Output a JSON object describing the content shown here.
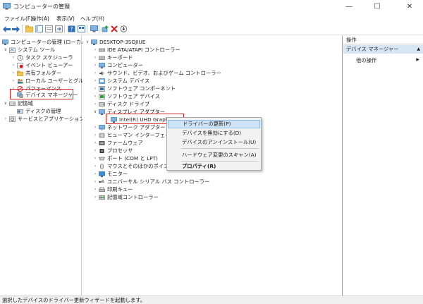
{
  "window": {
    "title": "コンピューターの管理",
    "controls": {
      "minimize": "—",
      "maximize": "☐",
      "close": "✕"
    }
  },
  "menu": [
    "ファイル(F)",
    "操作(A)",
    "表示(V)",
    "ヘルプ(H)"
  ],
  "toolbar_icons": [
    "back-arrow-icon",
    "forward-arrow-icon",
    "up-folder-icon",
    "console-tree-icon",
    "properties-icon",
    "export-list-icon",
    "help-icon",
    "view-icon",
    "monitor-icon",
    "update-driver-icon",
    "uninstall-icon",
    "scan-icon"
  ],
  "left_tree": [
    {
      "label": "コンピューターの管理 (ローカル)",
      "expander": "",
      "icon": "computer-management-icon",
      "level": 0
    },
    {
      "label": "システム ツール",
      "expander": "∨",
      "icon": "system-tools-icon",
      "level": 1
    },
    {
      "label": "タスク スケジューラ",
      "expander": "›",
      "icon": "task-scheduler-icon",
      "level": 2
    },
    {
      "label": "イベント ビューアー",
      "expander": "›",
      "icon": "event-viewer-icon",
      "level": 2
    },
    {
      "label": "共有フォルダー",
      "expander": "›",
      "icon": "shared-folder-icon",
      "level": 2
    },
    {
      "label": "ローカル ユーザーとグループ",
      "expander": "›",
      "icon": "users-icon",
      "level": 2
    },
    {
      "label": "パフォーマンス",
      "expander": "›",
      "icon": "performance-icon",
      "level": 2
    },
    {
      "label": "デバイス マネージャー",
      "expander": "",
      "icon": "device-manager-icon",
      "level": 2
    },
    {
      "label": "記憶域",
      "expander": "∨",
      "icon": "storage-icon",
      "level": 1
    },
    {
      "label": "ディスクの管理",
      "expander": "",
      "icon": "disk-management-icon",
      "level": 2
    },
    {
      "label": "サービスとアプリケーション",
      "expander": "›",
      "icon": "services-icon",
      "level": 1
    }
  ],
  "device_tree": [
    {
      "label": "DESKTOP-3SOJIUE",
      "expander": "∨",
      "icon": "computer-icon",
      "level": 0
    },
    {
      "label": "IDE ATA/ATAPI コントローラー",
      "expander": "›",
      "icon": "ide-controller-icon",
      "level": 1
    },
    {
      "label": "キーボード",
      "expander": "›",
      "icon": "keyboard-icon",
      "level": 1
    },
    {
      "label": "コンピューター",
      "expander": "›",
      "icon": "computer-icon",
      "level": 1
    },
    {
      "label": "サウンド、ビデオ、およびゲーム コントローラー",
      "expander": "›",
      "icon": "sound-icon",
      "level": 1
    },
    {
      "label": "システム デバイス",
      "expander": "›",
      "icon": "system-device-icon",
      "level": 1
    },
    {
      "label": "ソフトウェア コンポーネント",
      "expander": "›",
      "icon": "software-component-icon",
      "level": 1
    },
    {
      "label": "ソフトウェア デバイス",
      "expander": "›",
      "icon": "software-device-icon",
      "level": 1
    },
    {
      "label": "ディスク ドライブ",
      "expander": "›",
      "icon": "disk-drive-icon",
      "level": 1
    },
    {
      "label": "ディスプレイ アダプター",
      "expander": "∨",
      "icon": "display-adapter-icon",
      "level": 1
    },
    {
      "label": "Intel(R) UHD Graphics 750",
      "expander": "",
      "icon": "display-device-icon",
      "level": 2
    },
    {
      "label": "ネットワーク アダプター",
      "expander": "›",
      "icon": "network-adapter-icon",
      "level": 1
    },
    {
      "label": "ヒューマン インターフェイス デバ",
      "expander": "›",
      "icon": "hid-icon",
      "level": 1
    },
    {
      "label": "ファームウェア",
      "expander": "›",
      "icon": "firmware-icon",
      "level": 1
    },
    {
      "label": "プロセッサ",
      "expander": "›",
      "icon": "processor-icon",
      "level": 1
    },
    {
      "label": "ポート (COM と LPT)",
      "expander": "›",
      "icon": "port-icon",
      "level": 1
    },
    {
      "label": "マウスとそのほかのポインティング",
      "expander": "›",
      "icon": "mouse-icon",
      "level": 1
    },
    {
      "label": "モニター",
      "expander": "›",
      "icon": "monitor-icon",
      "level": 1
    },
    {
      "label": "ユニバーサル シリアル バス コントローラー",
      "expander": "›",
      "icon": "usb-icon",
      "level": 1
    },
    {
      "label": "印刷キュー",
      "expander": "›",
      "icon": "print-queue-icon",
      "level": 1
    },
    {
      "label": "記憶域コントローラー",
      "expander": "›",
      "icon": "storage-controller-icon",
      "level": 1
    }
  ],
  "context_menu": {
    "update_driver": "ドライバーの更新(P)",
    "disable_device": "デバイスを無効にする(D)",
    "uninstall_device": "デバイスのアンインストール(U)",
    "scan_hardware": "ハードウェア変更のスキャン(A)",
    "properties": "プロパティ(R)"
  },
  "actions": {
    "header": "操作",
    "section": "デバイス マネージャー",
    "section_arrow": "▲",
    "more": "他の操作",
    "more_arrow": "▶"
  },
  "statusbar": {
    "text": "選択したデバイスのドライバー更新ウィザードを起動します。"
  },
  "colors": {
    "highlight_border": "#d9262b",
    "selection": "#cfe4f7",
    "action_section_bg": "#d7e6f5"
  }
}
